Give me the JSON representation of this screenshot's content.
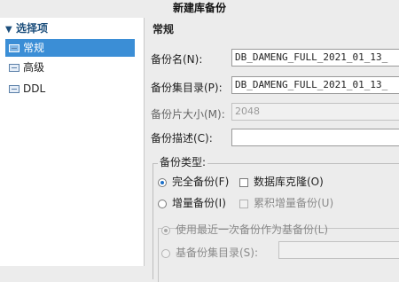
{
  "window": {
    "title": "新建库备份"
  },
  "nav": {
    "header": "选择项",
    "items": [
      {
        "label": "常规"
      },
      {
        "label": "高级"
      },
      {
        "label": "DDL"
      }
    ]
  },
  "form": {
    "section_title": "常规",
    "backup_name": {
      "label": "备份名(N):",
      "value": "DB_DAMENG_FULL_2021_01_13_"
    },
    "backup_dir": {
      "label": "备份集目录(P):",
      "value": "DB_DAMENG_FULL_2021_01_13_"
    },
    "piece_size": {
      "label": "备份片大小(M):",
      "value": "2048"
    },
    "description": {
      "label": "备份描述(C):",
      "value": ""
    },
    "backup_type": {
      "title": "备份类型:",
      "full": "完全备份(F)",
      "clone": "数据库克隆(O)",
      "incremental": "增量备份(I)",
      "cumulative": "累积增量备份(U)",
      "use_latest": "使用最近一次备份作为基备份(L)",
      "base_dir": "基备份集目录(S):"
    }
  }
}
